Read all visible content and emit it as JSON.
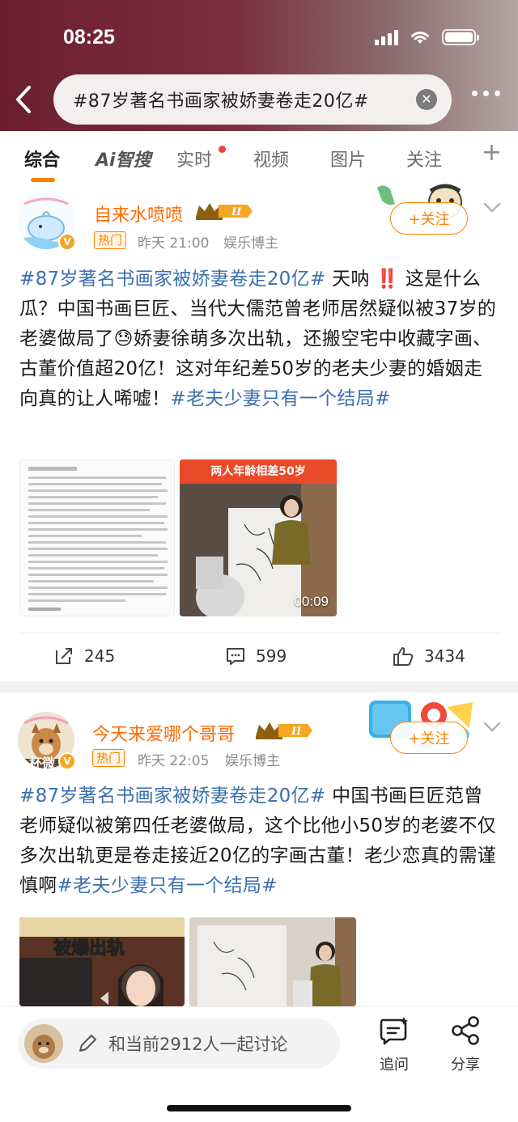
{
  "status": {
    "time": "08:25"
  },
  "search": {
    "query": "#87岁著名书画家被娇妻卷走20亿#"
  },
  "tabs": [
    {
      "label": "综合"
    },
    {
      "label": "Ai智搜"
    },
    {
      "label": "实时"
    },
    {
      "label": "视频"
    },
    {
      "label": "图片"
    },
    {
      "label": "关注"
    }
  ],
  "posts": [
    {
      "username": "自来水喷喷",
      "level": "Ⅱ",
      "hot_label": "热门",
      "time": "昨天 21:00",
      "category": "娱乐博主",
      "follow_label": "+关注",
      "text_tag_start": "#87岁著名书画家被娇妻卷走20亿#",
      "text_body": " 天呐 ‼️ 这是什么瓜？中国书画巨匠、当代大儒范曾老师居然疑似被37岁的老婆做局了😓娇妻徐萌多次出轨，还搬空宅中收藏字画、古董价值超20亿！这对年纪差50岁的老夫少妻的婚姻走向真的让人唏嘘！",
      "text_tag_end": "#老夫少妻只有一个结局#",
      "video_caption": "两人年龄相差50岁",
      "video_duration": "00:09",
      "reposts": "245",
      "comments": "599",
      "likes": "3434"
    },
    {
      "username": "今天来爱哪个哥哥",
      "level": "Ⅱ",
      "hot_label": "热门",
      "time": "昨天 22:05",
      "category": "娱乐博主",
      "follow_label": "+关注",
      "avatar_text": "杯微",
      "text_tag_start": "#87岁著名书画家被娇妻卷走20亿#",
      "text_body": " 中国书画巨匠范曾老师疑似被第四任老婆做局，这个比他小50岁的老婆不仅多次出轨更是卷走接近20亿的字画古董！老少恋真的需谨慎啊",
      "text_tag_end": "#老夫少妻只有一个结局#",
      "image_caption": "被爆出轨"
    }
  ],
  "bottom": {
    "comment_placeholder": "和当前2912人一起讨论",
    "followup_label": "追问",
    "share_label": "分享"
  },
  "colors": {
    "accent": "#ff8200",
    "tag": "#3a6fb0",
    "username": "#ff6a00",
    "header": "#6b1e2f"
  }
}
